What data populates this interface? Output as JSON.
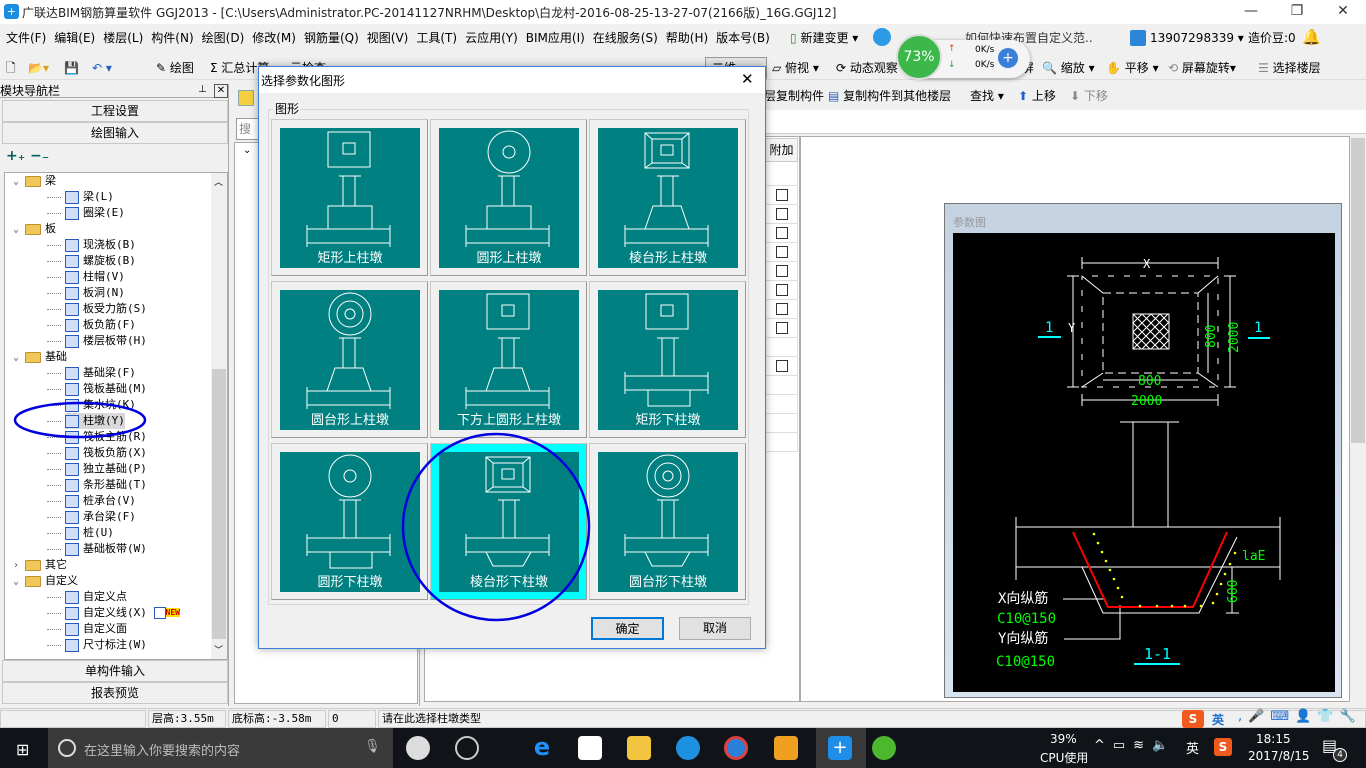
{
  "window": {
    "title": "广联达BIM钢筋算量软件 GGJ2013 - [C:\\Users\\Administrator.PC-20141127NRHM\\Desktop\\白龙村-2016-08-25-13-27-07(2166版)_16G.GGJ12]"
  },
  "menu": [
    "文件(F)",
    "编辑(E)",
    "楼层(L)",
    "构件(N)",
    "绘图(D)",
    "修改(M)",
    "钢筋量(Q)",
    "视图(V)",
    "工具(T)",
    "云应用(Y)",
    "BIM应用(I)",
    "在线服务(S)",
    "帮助(H)",
    "版本号(B)"
  ],
  "menu_extra": {
    "new_change": "新建变更",
    "tip": "如何快速布置自定义范..",
    "account": "13907298339",
    "beans": "造价豆:0"
  },
  "toolbar": {
    "draw": "绘图",
    "sum": "汇总计算",
    "check": "云检查",
    "view2d": "二维",
    "top_view": "俯视",
    "dynamic": "动态观察",
    "fullscreen": "全屏",
    "zoom": "缩放",
    "pan": "平移",
    "rotate": "屏幕旋转",
    "select_floor": "选择楼层"
  },
  "toolbar2": {
    "copy_from": "层复制构件",
    "copy_to": "复制构件到其他楼层",
    "find": "查找",
    "up": "上移",
    "down": "下移"
  },
  "net_widget": {
    "cpu": "73%",
    "up": "0K/s",
    "down": "0K/s"
  },
  "nav": {
    "title": "模块导航栏",
    "project": "工程设置",
    "draw_input": "绘图输入",
    "single": "单构件输入",
    "report": "报表预览",
    "tree": [
      {
        "label": "梁",
        "level": 0,
        "folder": true,
        "open": true
      },
      {
        "label": "梁(L)",
        "level": 1,
        "icon": "beam-icon"
      },
      {
        "label": "圈梁(E)",
        "level": 1,
        "icon": "ring-beam-icon"
      },
      {
        "label": "板",
        "level": 0,
        "folder": true,
        "open": true
      },
      {
        "label": "现浇板(B)",
        "level": 1,
        "icon": "slab-icon"
      },
      {
        "label": "螺旋板(B)",
        "level": 1,
        "icon": "spiral-slab-icon"
      },
      {
        "label": "柱帽(V)",
        "level": 1,
        "icon": "column-cap-icon"
      },
      {
        "label": "板洞(N)",
        "level": 1,
        "icon": "slab-hole-icon"
      },
      {
        "label": "板受力筋(S)",
        "level": 1,
        "icon": "slab-rebar-icon"
      },
      {
        "label": "板负筋(F)",
        "level": 1,
        "icon": "slab-neg-rebar-icon"
      },
      {
        "label": "楼层板带(H)",
        "level": 1,
        "icon": "slab-strip-icon"
      },
      {
        "label": "基础",
        "level": 0,
        "folder": true,
        "open": true
      },
      {
        "label": "基础梁(F)",
        "level": 1,
        "icon": "foundation-beam-icon"
      },
      {
        "label": "筏板基础(M)",
        "level": 1,
        "icon": "raft-icon"
      },
      {
        "label": "集水坑(K)",
        "level": 1,
        "icon": "sump-icon"
      },
      {
        "label": "柱墩(Y)",
        "level": 1,
        "icon": "column-pier-icon",
        "selected": true
      },
      {
        "label": "筏板主筋(R)",
        "level": 1,
        "icon": "raft-main-rebar-icon"
      },
      {
        "label": "筏板负筋(X)",
        "level": 1,
        "icon": "raft-neg-rebar-icon"
      },
      {
        "label": "独立基础(P)",
        "level": 1,
        "icon": "isolated-footing-icon"
      },
      {
        "label": "条形基础(T)",
        "level": 1,
        "icon": "strip-footing-icon"
      },
      {
        "label": "桩承台(V)",
        "level": 1,
        "icon": "pile-cap-icon"
      },
      {
        "label": "承台梁(F)",
        "level": 1,
        "icon": "cap-beam-icon"
      },
      {
        "label": "桩(U)",
        "level": 1,
        "icon": "pile-icon"
      },
      {
        "label": "基础板带(W)",
        "level": 1,
        "icon": "foundation-strip-icon"
      },
      {
        "label": "其它",
        "level": 0,
        "folder": true,
        "open": false
      },
      {
        "label": "自定义",
        "level": 0,
        "folder": true,
        "open": true
      },
      {
        "label": "自定义点",
        "level": 1,
        "icon": "custom-point-icon"
      },
      {
        "label": "自定义线(X)",
        "level": 1,
        "icon": "custom-line-icon",
        "badge": "NEW"
      },
      {
        "label": "自定义面",
        "level": 1,
        "icon": "custom-face-icon"
      },
      {
        "label": "尺寸标注(W)",
        "level": 1,
        "icon": "dimension-icon"
      }
    ]
  },
  "mid": {
    "search_placeholder": "搜索"
  },
  "table": {
    "header": "附加"
  },
  "dialog": {
    "title": "选择参数化图形",
    "group": "图形",
    "ok": "确定",
    "cancel": "取消",
    "tiles": [
      {
        "label": "矩形上柱墩",
        "plan": "rect",
        "pier": "rect-up"
      },
      {
        "label": "圆形上柱墩",
        "plan": "circle",
        "pier": "rect-up"
      },
      {
        "label": "棱台形上柱墩",
        "plan": "frustum-rect",
        "pier": "frustum-up"
      },
      {
        "label": "圆台形上柱墩",
        "plan": "rings",
        "pier": "frustum-up"
      },
      {
        "label": "下方上圆形上柱墩",
        "plan": "rect",
        "pier": "frustum-up"
      },
      {
        "label": "矩形下柱墩",
        "plan": "rect",
        "pier": "rect-down"
      },
      {
        "label": "圆形下柱墩",
        "plan": "circle",
        "pier": "rect-down"
      },
      {
        "label": "棱台形下柱墩",
        "plan": "frustum-rect",
        "pier": "frustum-down",
        "selected": true
      },
      {
        "label": "圆台形下柱墩",
        "plan": "rings",
        "pier": "frustum-down"
      }
    ]
  },
  "param": {
    "title": "参数图",
    "x": "X",
    "y": "Y",
    "sec_left": "1",
    "sec_right": "1",
    "inner_v": "800",
    "outer_v": "2000",
    "inner_h": "800",
    "outer_h": "2000",
    "lae": "laE",
    "depth": "600",
    "x_rebar": "X向纵筋",
    "x_rebar_val": "C10@150",
    "y_rebar": "Y向纵筋",
    "y_rebar_val": "C10@150",
    "section": "1-1"
  },
  "status": {
    "floor_height": "层高:3.55m",
    "bottom_elev": "底标高:-3.58m",
    "value": "0",
    "hint": "请在此选择柱墩类型"
  },
  "taskbar": {
    "search": "在这里输入你要搜索的内容",
    "cpu": "39%",
    "cpu_label": "CPU使用",
    "ime": "英",
    "time": "18:15",
    "date": "2017/8/15",
    "notif": "4"
  },
  "colors": {
    "teal": "#008080",
    "selected": "#00ffff",
    "annotation": "#0000e0"
  }
}
